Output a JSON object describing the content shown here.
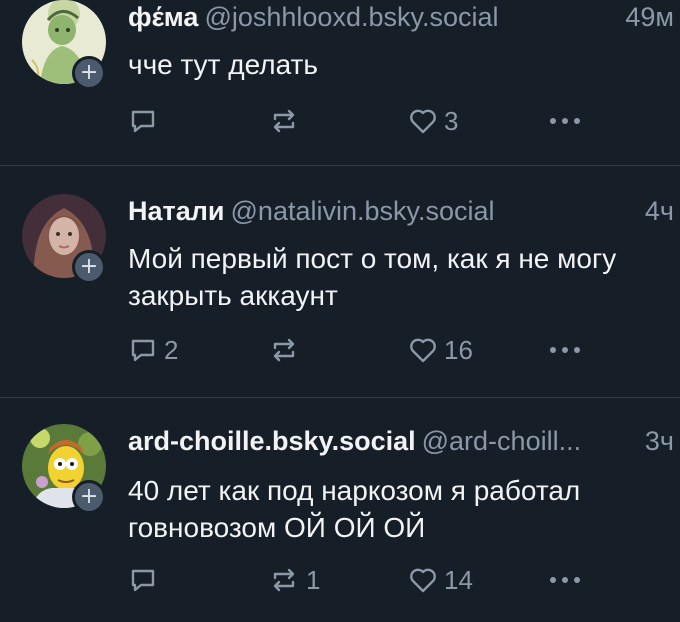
{
  "posts": [
    {
      "name": "фέма",
      "handle": "@joshhlooxd.bsky.social",
      "time": "49м",
      "text": "чче тут делать",
      "reply_count": "",
      "repost_count": "",
      "like_count": "3"
    },
    {
      "name": "Натали",
      "handle": "@natalivin.bsky.social",
      "time": "4ч",
      "text": "Мой первый пост о том, как я не могу закрыть аккаунт",
      "reply_count": "2",
      "repost_count": "",
      "like_count": "16"
    },
    {
      "name": "ard-choille.bsky.social",
      "handle": "@ard-choill...",
      "time": "3ч",
      "text": "40 лет как под наркозом я работал говновозом ОЙ ОЙ ОЙ",
      "reply_count": "",
      "repost_count": "1",
      "like_count": "14"
    }
  ],
  "plus_symbol": "+",
  "colors": {
    "background": "#161e27",
    "text": "#f1f3f5",
    "muted": "#8b98a7",
    "divider": "#2e3b4a"
  },
  "icons": [
    "reply-icon",
    "repost-icon",
    "like-heart-icon",
    "more-options-icon",
    "follow-plus-icon"
  ]
}
